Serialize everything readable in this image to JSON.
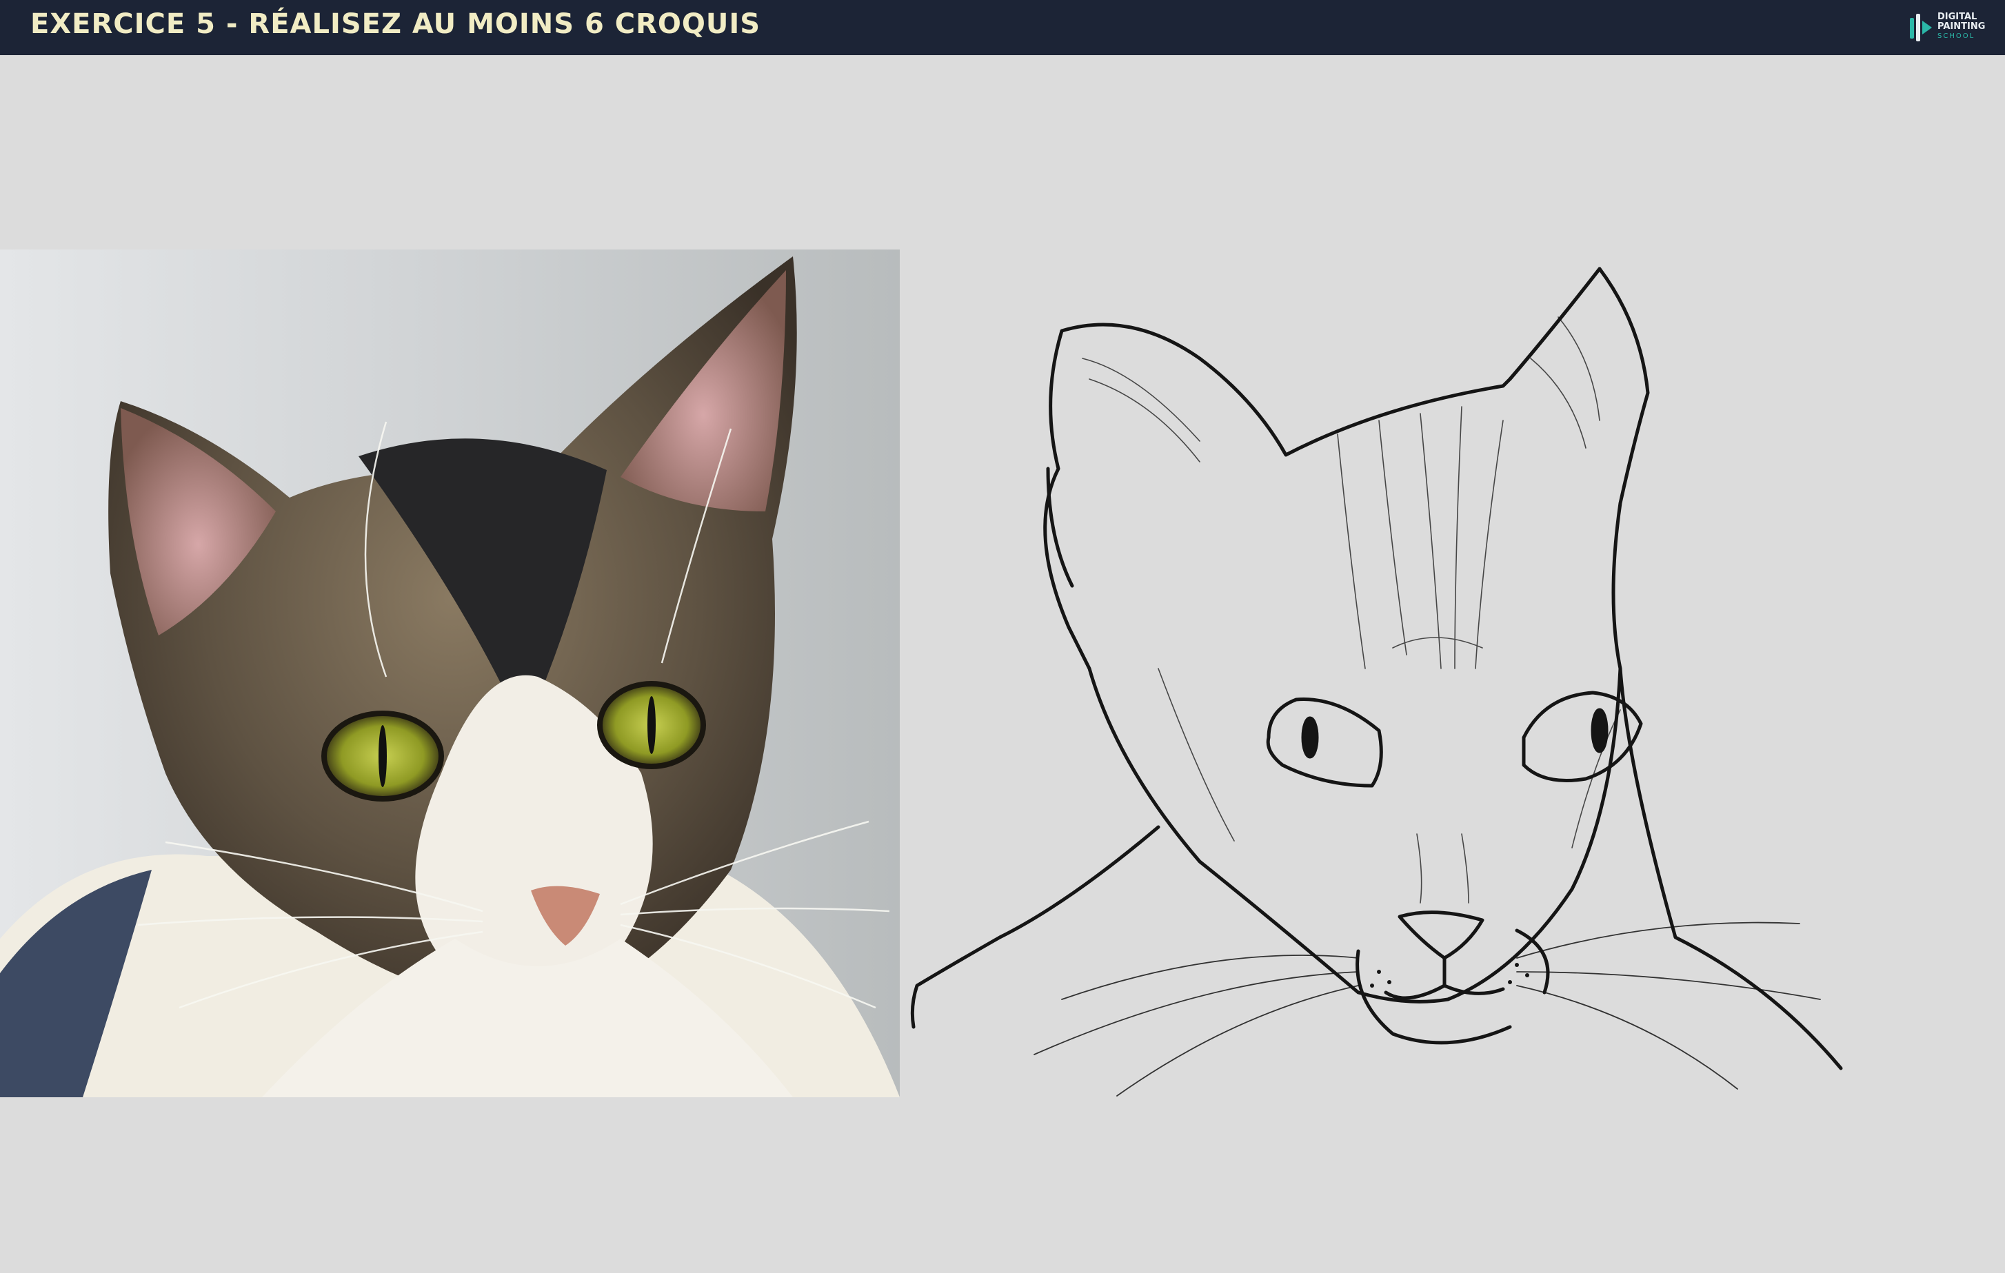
{
  "header": {
    "title": "EXERCICE 5 - RÉALISEZ AU MOINS 6 CROQUIS",
    "logo_line1": "DIGITAL",
    "logo_line2": "PAINTING",
    "logo_line3": "SCHOOL"
  },
  "colors": {
    "header_bg": "#1c2436",
    "title_text": "#f1ecc4",
    "page_bg": "#dcdcdc",
    "logo_accent": "#2bb7a8"
  },
  "icons": {
    "logo": "brush-logo-icon"
  }
}
